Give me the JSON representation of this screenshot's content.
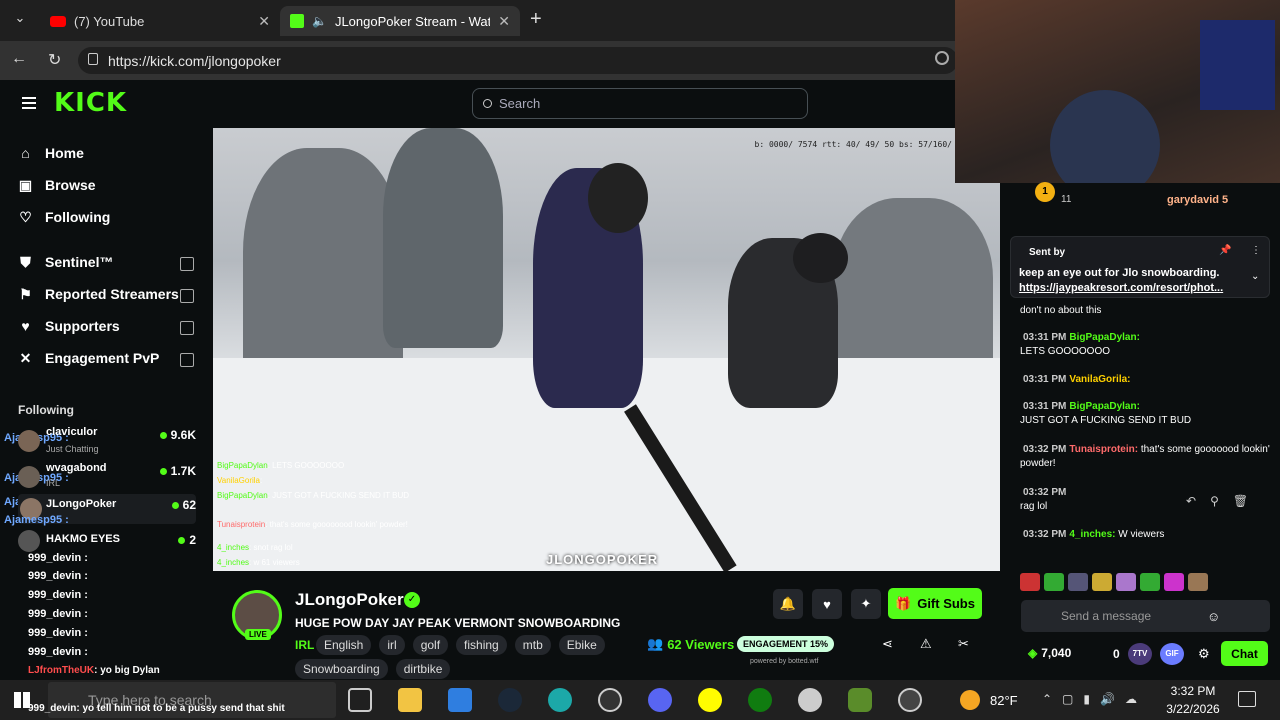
{
  "browser": {
    "tabs": [
      {
        "title": "(7) YouTube",
        "active": false
      },
      {
        "title": "JLongoPoker Stream - Watch",
        "active": true
      }
    ],
    "url": "https://kick.com/jlongopoker"
  },
  "kick": {
    "logo": "KICK",
    "search_placeholder": "Search",
    "nav": [
      {
        "label": "Home",
        "icon": "home-icon"
      },
      {
        "label": "Browse",
        "icon": "browse-icon"
      },
      {
        "label": "Following",
        "icon": "heart-icon"
      }
    ],
    "nav_locked": [
      {
        "label": "Sentinel™",
        "icon": "shield-icon"
      },
      {
        "label": "Reported Streamers",
        "icon": "flag-icon"
      },
      {
        "label": "Supporters",
        "icon": "heart-icon"
      },
      {
        "label": "Engagement PvP",
        "icon": "versus-icon"
      }
    ],
    "following_header": "Following",
    "following": [
      {
        "name": "claviculor",
        "sub": "Just Chatting",
        "count": "9.6K"
      },
      {
        "name": "wvagabond",
        "sub": "IRL",
        "count": "1.7K"
      },
      {
        "name": "JLongoPoker",
        "sub": "",
        "count": "62"
      },
      {
        "name": "HAKMO EYES",
        "sub": "",
        "count": "2"
      }
    ],
    "overlay_chat_left": [
      "Ajamesp95 :",
      "Ajamesp95 :",
      "Ajamesp95 :",
      "Ajamesp95 :",
      "999_devin :",
      "999_devin :",
      "999_devin :",
      "999_devin :",
      "999_devin :",
      "999_devin :"
    ],
    "overlay_last": [
      {
        "user": "LJfromTheUK",
        "text": "yo big Dylan"
      },
      {
        "user": "999_devin",
        "text": "yo tell him not to be a pussy send that shit"
      }
    ]
  },
  "video": {
    "stats": "b: 0000/ 7574 rtt: 40/ 49/ 50 bs: 57/160/",
    "overlay_chat": [
      {
        "user": "BigPapaDylan",
        "text": "LETS GOOOOOOO"
      },
      {
        "user": "VanilaGorila",
        "text": ""
      },
      {
        "user": "BigPapaDylan",
        "text": "JUST GOT A FUCKING SEND IT BUD"
      },
      {
        "user": "Tunaisprotein",
        "text": "that's some goooooood lookin' powder!"
      },
      {
        "user": "4_inches",
        "text": "snot rag lol"
      },
      {
        "user": "4_inches",
        "text": "w 61 viewers"
      }
    ],
    "watermark": "JLONGOPOKER"
  },
  "stream": {
    "streamer": "JLongoPoker",
    "live_label": "LIVE",
    "title": "HUGE POW DAY JAY PEAK VERMONT SNOWBOARDING",
    "category": "IRL",
    "tags": [
      "English",
      "irl",
      "golf",
      "fishing",
      "mtb",
      "Ebike"
    ],
    "tags2": [
      "Snowboarding",
      "dirtbike"
    ],
    "viewers": "62 Viewers",
    "engagement": "ENGAGEMENT 15%",
    "powered_by": "powered by botted.wtf",
    "gift_label": "Gift Subs"
  },
  "chat": {
    "top_users": [
      "garydavid 5"
    ],
    "top_count": "11",
    "pinned": {
      "sent_by": "Sent by",
      "message": "keep an eye out for Jlo snowboarding.",
      "link": "https://jaypeakresort.com/resort/phot..."
    },
    "messages": [
      {
        "time": "",
        "user": "",
        "text": "don't no about this"
      },
      {
        "time": "03:31 PM",
        "user": "BigPapaDylan:",
        "text": "LETS GOOOOOOO"
      },
      {
        "time": "03:31 PM",
        "user": "VanilaGorila:",
        "text": ""
      },
      {
        "time": "03:31 PM",
        "user": "BigPapaDylan:",
        "text": "JUST GOT A FUCKING SEND IT BUD"
      },
      {
        "time": "03:32 PM",
        "user": "Tunaisprotein:",
        "text": "that's some gooooood lookin' powder!"
      },
      {
        "time": "03:32 PM",
        "user": "",
        "text": "rag lol"
      },
      {
        "time": "03:32 PM",
        "user": "4_inches:",
        "text": "W viewers"
      }
    ],
    "input_placeholder": "Send a message",
    "points": "7,040",
    "zero": "0",
    "chat_button": "Chat",
    "ttv": "7TV",
    "gif": "GIF"
  },
  "taskbar": {
    "search_placeholder": "Type here to search",
    "weather": "82°F",
    "time": "3:32 PM",
    "date": "3/22/2026"
  }
}
